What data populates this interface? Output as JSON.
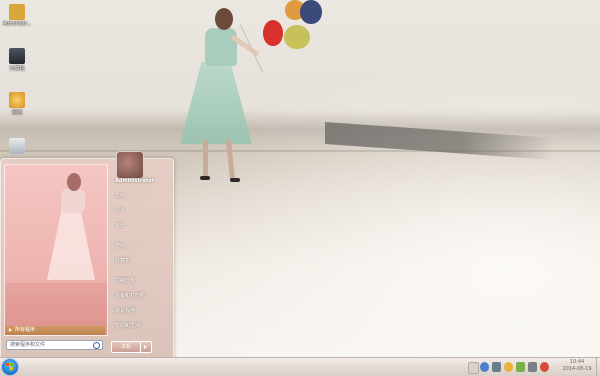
{
  "desktop": {
    "icons": [
      {
        "label": "Administr...",
        "icon": "user-folder-icon",
        "color": "#d9a63d"
      },
      {
        "label": "计算机",
        "icon": "computer-icon",
        "color": "#3a3f48"
      },
      {
        "label": "网络",
        "icon": "network-icon",
        "color": "#e3a533"
      },
      {
        "label": "",
        "icon": "recycle-bin-icon",
        "color": "#cfd4d8"
      }
    ]
  },
  "start_menu": {
    "user_name": "Administrator",
    "right_items": [
      "文档",
      "图片",
      "音乐",
      "游戏",
      "计算机",
      "控制面板",
      "设备和打印机",
      "默认程序",
      "帮助和支持"
    ],
    "all_programs_label": "所有程序",
    "search_placeholder": "搜索程序和文件",
    "shutdown_label": "关机"
  },
  "taskbar": {
    "clock_time": "10:44",
    "clock_date": "2014-08-19"
  },
  "colors": {
    "start_orb": "#2c83d6",
    "menu_left_pane": "#f0bcb8",
    "all_programs_bar": "#c58f5a"
  }
}
